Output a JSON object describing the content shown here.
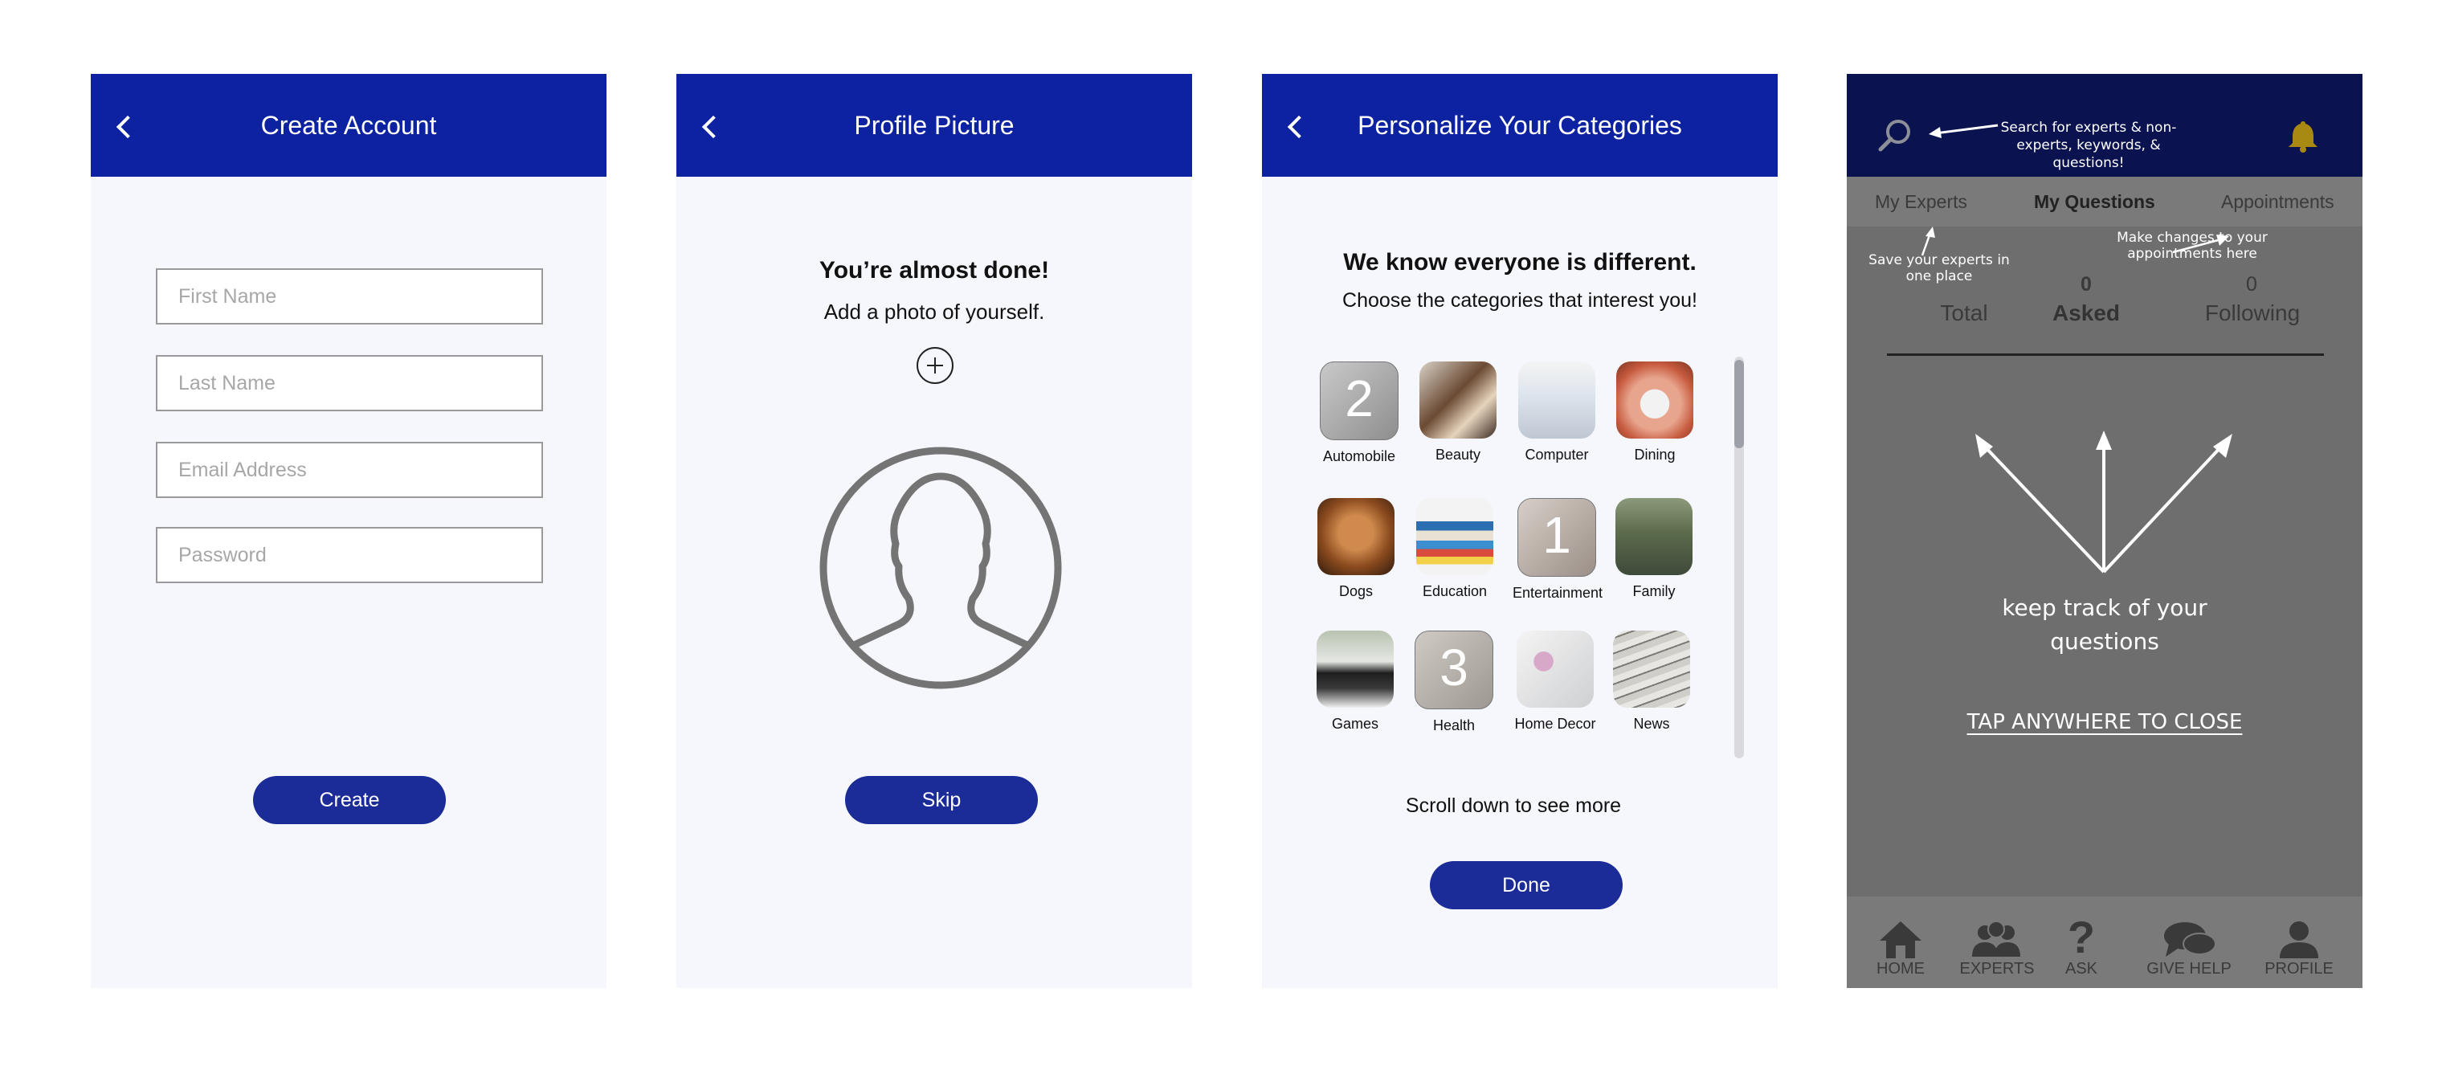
{
  "screen1": {
    "title": "Create Account",
    "fields": {
      "first": "First Name",
      "last": "Last Name",
      "email": "Email Address",
      "password": "Password"
    },
    "button": "Create"
  },
  "screen2": {
    "title": "Profile Picture",
    "heading": "You’re almost done!",
    "sub": "Add a photo of yourself.",
    "button": "Skip"
  },
  "screen3": {
    "title": "Personalize Your Categories",
    "heading": "We know everyone is different.",
    "sub": "Choose the categories that interest you!",
    "categories": [
      {
        "label": "Automobile",
        "badge": "2"
      },
      {
        "label": "Beauty"
      },
      {
        "label": "Computer"
      },
      {
        "label": "Dining"
      },
      {
        "label": "Dogs"
      },
      {
        "label": "Education"
      },
      {
        "label": "Entertainment",
        "badge": "1"
      },
      {
        "label": "Family"
      },
      {
        "label": "Games"
      },
      {
        "label": "Health",
        "badge": "3"
      },
      {
        "label": "Home Decor"
      },
      {
        "label": "News"
      }
    ],
    "scroll_hint": "Scroll down to see more",
    "button": "Done"
  },
  "screen4": {
    "tabs": [
      "My Experts",
      "My Questions",
      "Appointments"
    ],
    "stats": [
      {
        "value": "",
        "label": "Total"
      },
      {
        "value": "0",
        "label": "Asked"
      },
      {
        "value": "0",
        "label": "Following"
      }
    ],
    "annotations": {
      "search": "Search for experts & non-experts, keywords, & questions!",
      "save": "Save your experts in one place",
      "appointments": "Make changes to your appointments here",
      "track": "keep track of your questions",
      "close": "TAP ANYWHERE TO CLOSE"
    },
    "nav": [
      {
        "label": "HOME",
        "icon": "home-icon"
      },
      {
        "label": "EXPERTS",
        "icon": "experts-icon"
      },
      {
        "label": "ASK",
        "icon": "question-icon"
      },
      {
        "label": "GIVE HELP",
        "icon": "chat-icon"
      },
      {
        "label": "PROFILE",
        "icon": "profile-icon"
      }
    ]
  },
  "colors": {
    "appbar": "#0c22a0",
    "button": "#1b2b98",
    "overlay": "#6e6e6e",
    "bell": "#a88a12"
  }
}
